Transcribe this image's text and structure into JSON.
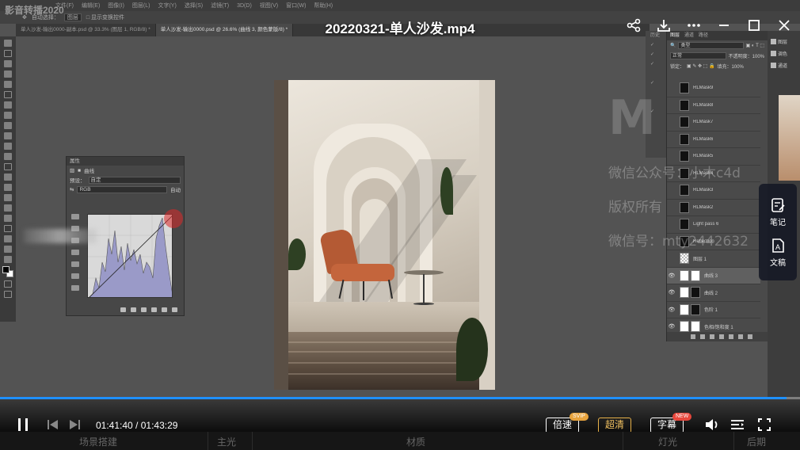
{
  "brand": "影音转播2020",
  "video_title": "20220321-单人沙发.mp4",
  "ps": {
    "tabs": [
      "单人沙发-输出0000-副本.psd @ 33.3% (图层 1, RGB/8) *",
      "单人沙发-输出0000.psd @ 26.6% (曲线 3, 颜色蒙版/8) *"
    ],
    "properties_title": "属性",
    "properties_label": "曲线",
    "preset_label": "预设：",
    "preset_value": "自定",
    "channel_value": "RGB",
    "auto_label": "自动",
    "layer_tabs": [
      "图层",
      "通道",
      "路径"
    ],
    "kind_label": "类型",
    "blend_mode": "正常",
    "opacity_label": "不透明度：100%",
    "lock_label": "锁定：",
    "fill_label": "填充：100%",
    "layers": [
      {
        "name": "RLMask9",
        "visible": false
      },
      {
        "name": "RLMask8",
        "visible": false
      },
      {
        "name": "RLMask7",
        "visible": false
      },
      {
        "name": "RLMask6",
        "visible": false
      },
      {
        "name": "RLMask5",
        "visible": false
      },
      {
        "name": "RLMask4",
        "visible": false
      },
      {
        "name": "RLMask3",
        "visible": false
      },
      {
        "name": "RLMask2",
        "visible": false
      },
      {
        "name": "Light pass 6",
        "visible": false
      },
      {
        "name": "Reflection",
        "visible": false
      },
      {
        "name": "图层 1",
        "visible": false
      },
      {
        "name": "曲线 3",
        "visible": true
      },
      {
        "name": "曲线 2",
        "visible": true
      },
      {
        "name": "色阶 1",
        "visible": true
      },
      {
        "name": "色相/饱和度 1",
        "visible": true
      }
    ],
    "right_panel_items": [
      "图层",
      "调色",
      "通道"
    ]
  },
  "watermark": {
    "line1": "微信公众号：小木c4d",
    "line2": "版权所有",
    "line3": "微信号：mty2442632"
  },
  "side_panel": {
    "notes_label": "笔记",
    "transcript_label": "文稿"
  },
  "player": {
    "current_time": "01:41:40",
    "separator": " / ",
    "total_time": "01:43:29",
    "progress": 0.983,
    "speed_label": "倍速",
    "speed_badge": "SVIP",
    "quality_label": "超清",
    "subtitle_label": "字幕",
    "subtitle_badge": "NEW",
    "badge_svip_color": "#e8a33c",
    "badge_new_color": "#e8473c",
    "accent_color": "#1e90ff"
  },
  "chapters": [
    "场景搭建",
    "主光",
    "材质",
    "灯光",
    "后期"
  ]
}
